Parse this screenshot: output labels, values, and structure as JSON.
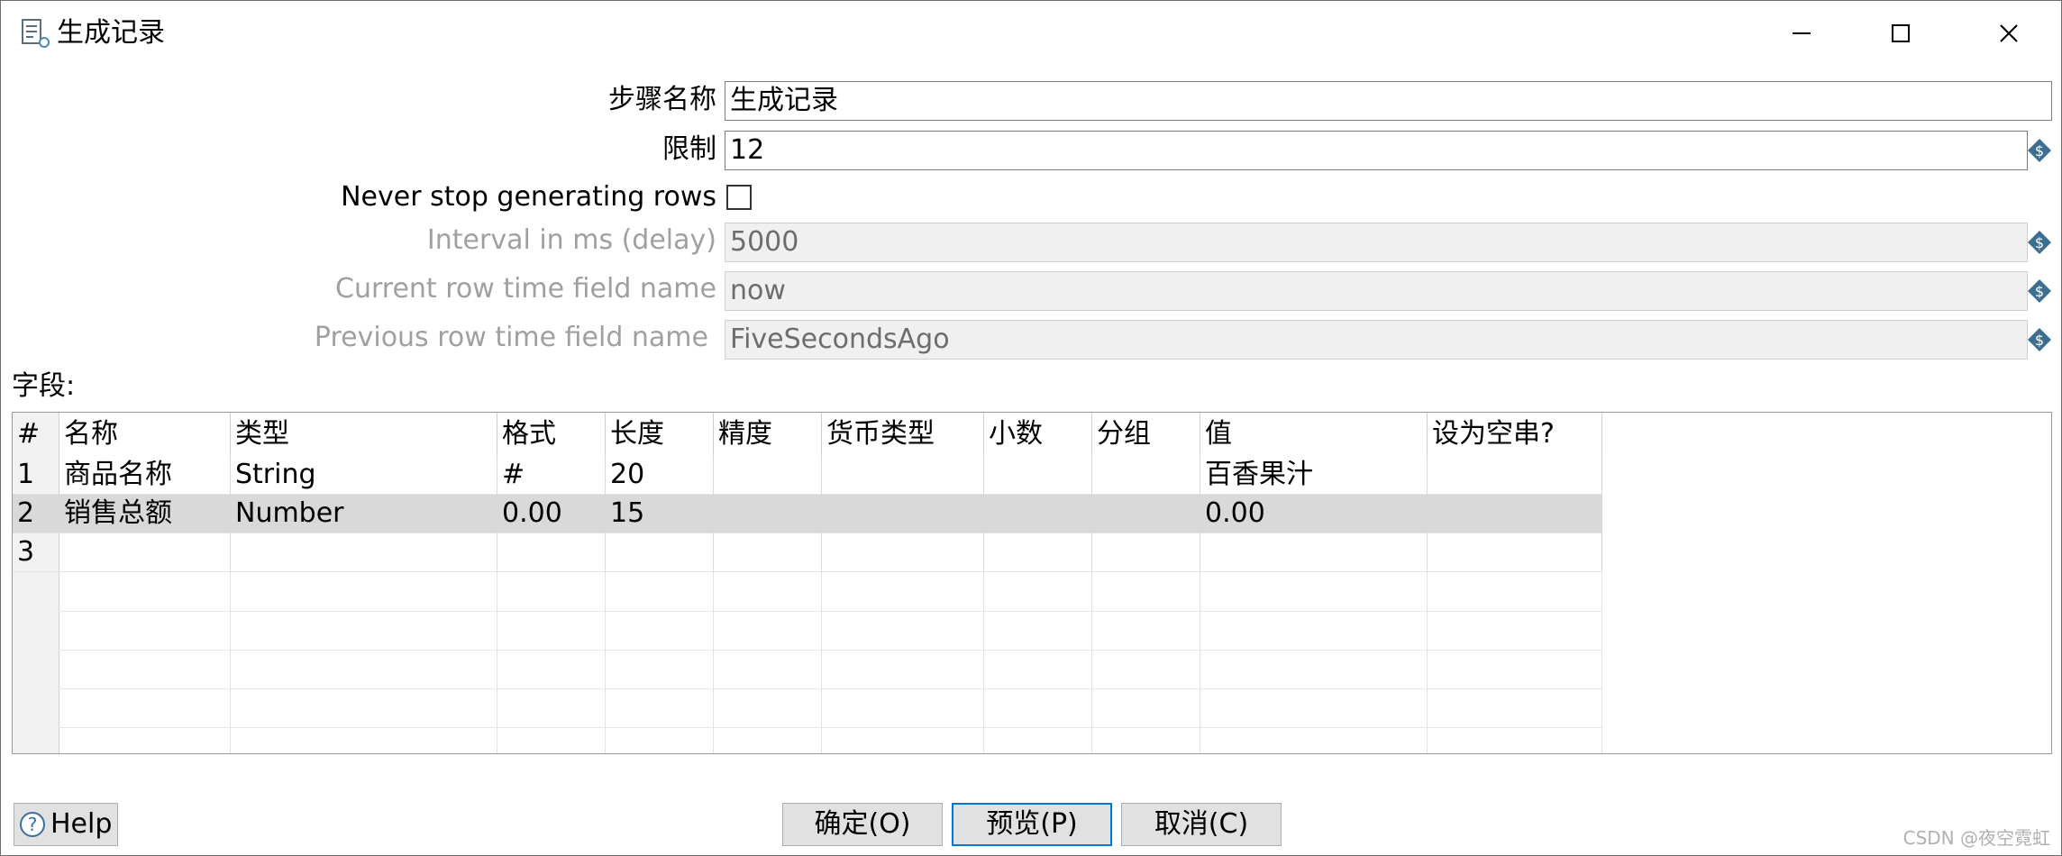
{
  "window": {
    "title": "生成记录"
  },
  "form": {
    "step_name_label": "步骤名称",
    "step_name_value": "生成记录",
    "limit_label": "限制",
    "limit_value": "12",
    "never_stop_label": "Never stop generating rows",
    "never_stop_checked": false,
    "interval_label": "Interval in ms (delay)",
    "interval_value": "5000",
    "current_time_label": "Current row time field name",
    "current_time_value": "now",
    "previous_time_label": "Previous row time field name",
    "previous_time_value": "FiveSecondsAgo"
  },
  "fields": {
    "label": "字段:",
    "columns": [
      "#",
      "名称",
      "类型",
      "格式",
      "长度",
      "精度",
      "货币类型",
      "小数",
      "分组",
      "值",
      "设为空串?"
    ],
    "rows": [
      [
        "1",
        "商品名称",
        "String",
        "#",
        "20",
        "",
        "",
        "",
        "",
        "百香果汁",
        ""
      ],
      [
        "2",
        "销售总额",
        "Number",
        "0.00",
        "15",
        "",
        "",
        "",
        "",
        "0.00",
        ""
      ],
      [
        "3",
        "",
        "",
        "",
        "",
        "",
        "",
        "",
        "",
        "",
        ""
      ]
    ],
    "selected_row": 2
  },
  "buttons": {
    "help": "Help",
    "ok": "确定(O)",
    "preview": "预览(P)",
    "cancel": "取消(C)"
  },
  "watermark": "CSDN @夜空霓虹",
  "colors": {
    "focus": "#0078d7",
    "variable_icon": "#3c6e8f",
    "selected_row": "#d9d9d9"
  }
}
